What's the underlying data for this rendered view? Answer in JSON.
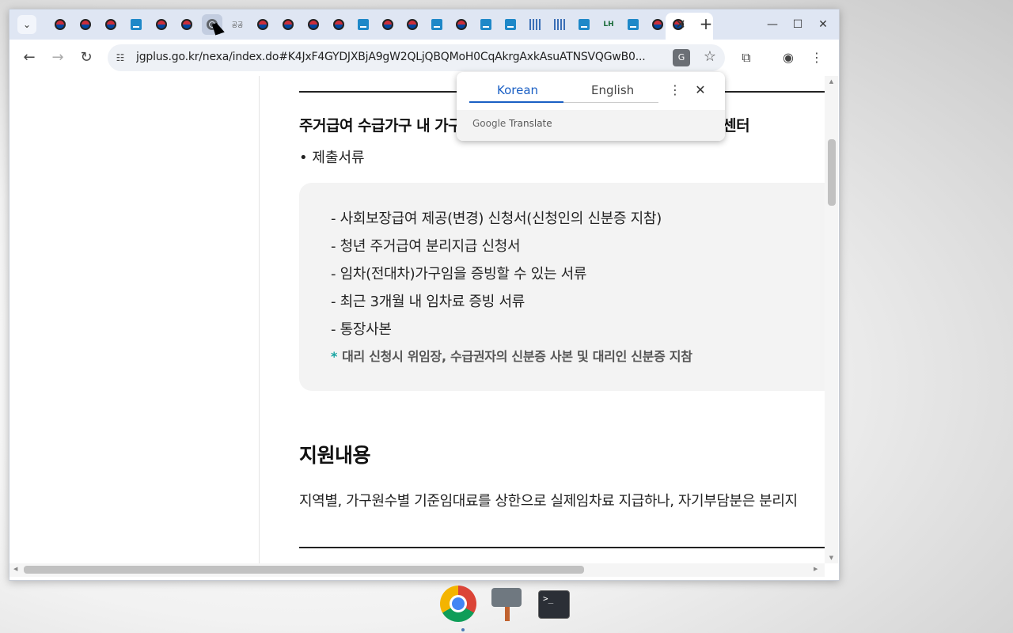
{
  "browser": {
    "tab_search_glyph": "⌄",
    "favicons": [
      "korea",
      "korea",
      "korea",
      "blue",
      "korea",
      "korea",
      "globe",
      "text",
      "korea",
      "korea",
      "korea",
      "korea",
      "blue",
      "korea",
      "korea",
      "blue",
      "korea",
      "blue",
      "blue",
      "bars",
      "bars",
      "blue",
      "lh",
      "blue",
      "korea"
    ],
    "favicon_text": "공공",
    "lh_text": "LH",
    "active_tab_close": "✕",
    "new_tab": "+",
    "window_controls": {
      "minimize": "—",
      "maximize": "☐",
      "close": "✕"
    },
    "nav": {
      "back": "←",
      "forward": "→",
      "reload": "↻"
    },
    "url": "jgplus.go.kr/nexa/index.do#K4JxF4GYDJXBjA9gW2QLjQBQMoH0CqAkrgAxkAsuATNSVQGwB0...",
    "translate_glyph": "G",
    "bookmark_glyph": "☆",
    "extensions_glyph": "⧉",
    "profile_glyph": "◉",
    "menu_glyph": "⋮"
  },
  "translate_popup": {
    "source_lang": "Korean",
    "target_lang": "English",
    "more_glyph": "⋮",
    "close_glyph": "✕",
    "brand_google": "Google",
    "brand_translate": "Translate"
  },
  "page": {
    "eligibility_heading": "주거급여 수급가구 내 가구",
    "eligibility_heading_tail": "센터",
    "documents_bullet": "• 제출서류",
    "documents": [
      "- 사회보장급여 제공(변경) 신청서(신청인의 신분증 지참)",
      "- 청년 주거급여 분리지급 신청서",
      "- 임차(전대차)가구임을 증빙할 수 있는 서류",
      "- 최근 3개월 내 임차료 증빙 서류",
      "- 통장사본"
    ],
    "documents_note_star": "*",
    "documents_note": "대리 신청시 위임장, 수급권자의 신분증 사본 및 대리인 신분증 지참",
    "support_heading": "지원내용",
    "support_text": "지역별, 가구원수별 기준임대료를 상한으로 실제임차료 지급하나, 자기부담분은 분리지"
  },
  "taskbar": {
    "terminal_prompt": ">_"
  }
}
